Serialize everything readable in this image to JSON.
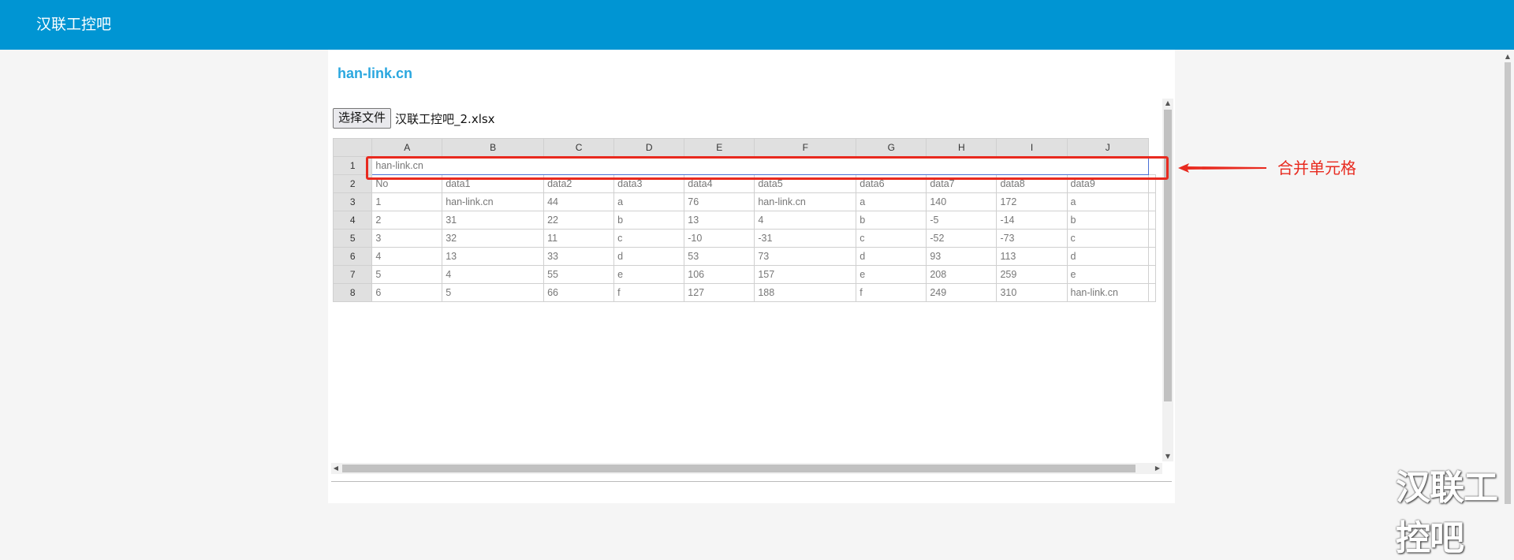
{
  "app": {
    "title": "汉联工控吧"
  },
  "site_link": "han-link.cn",
  "file_input": {
    "button_label": "选择文件",
    "file_name": "汉联工控吧_2.xlsx"
  },
  "sheet": {
    "columns": [
      "A",
      "B",
      "C",
      "D",
      "E",
      "F",
      "G",
      "H",
      "I",
      "J"
    ],
    "merged_row": {
      "row": "1",
      "value": "han-link.cn"
    },
    "rows": [
      {
        "n": "2",
        "cells": [
          "No",
          "data1",
          "data2",
          "data3",
          "data4",
          "data5",
          "data6",
          "data7",
          "data8",
          "data9"
        ]
      },
      {
        "n": "3",
        "cells": [
          "1",
          "han-link.cn",
          "44",
          "a",
          "76",
          "han-link.cn",
          "a",
          "140",
          "172",
          "a"
        ]
      },
      {
        "n": "4",
        "cells": [
          "2",
          "31",
          "22",
          "b",
          "13",
          "4",
          "b",
          "-5",
          "-14",
          "b"
        ]
      },
      {
        "n": "5",
        "cells": [
          "3",
          "32",
          "11",
          "c",
          "-10",
          "-31",
          "c",
          "-52",
          "-73",
          "c"
        ]
      },
      {
        "n": "6",
        "cells": [
          "4",
          "13",
          "33",
          "d",
          "53",
          "73",
          "d",
          "93",
          "113",
          "d"
        ]
      },
      {
        "n": "7",
        "cells": [
          "5",
          "4",
          "55",
          "e",
          "106",
          "157",
          "e",
          "208",
          "259",
          "e"
        ]
      },
      {
        "n": "8",
        "cells": [
          "6",
          "5",
          "66",
          "f",
          "127",
          "188",
          "f",
          "249",
          "310",
          "han-link.cn"
        ]
      }
    ]
  },
  "annotation": {
    "label": "合并单元格",
    "color": "#e82a1f"
  },
  "watermark": "汉联工控吧",
  "colors": {
    "header_bar": "#0095d3",
    "link": "#2aa7df",
    "merge_border": "#4a6fd6"
  }
}
